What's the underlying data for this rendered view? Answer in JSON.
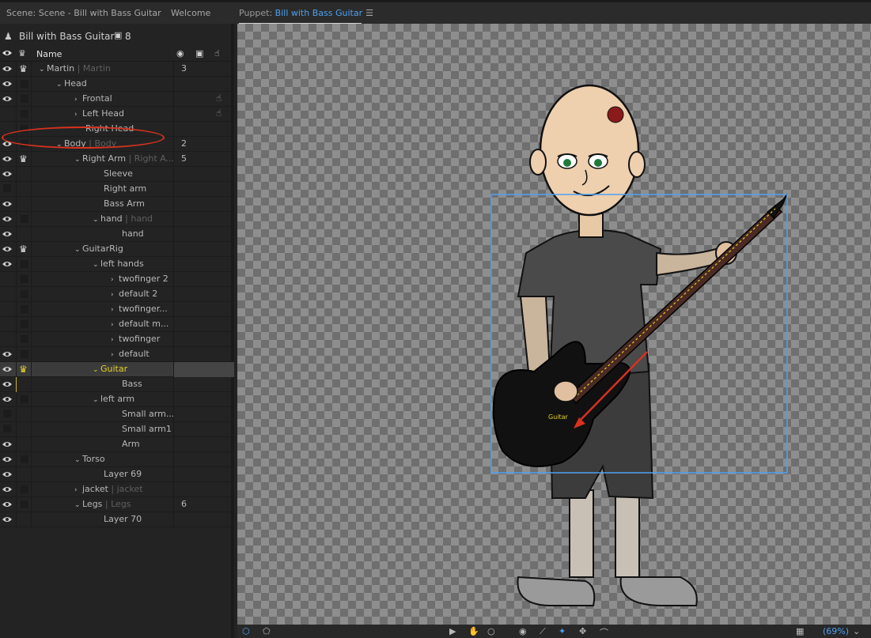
{
  "tabs": {
    "scene": "Scene: Scene - Bill with Bass Guitar",
    "welcome": "Welcome",
    "puppet_prefix": "Puppet: ",
    "puppet_name": "Bill with Bass Guitar"
  },
  "puppet_panel": {
    "title": "Bill with Bass Guitar",
    "count": "8",
    "column_name": "Name"
  },
  "layers": [
    {
      "label": "Martin",
      "suffix": "Martin",
      "num": "3",
      "caret": "⌄",
      "crown": true
    },
    {
      "label": "Head",
      "suffix": "",
      "num": "",
      "caret": "⌄"
    },
    {
      "label": "Frontal",
      "suffix": "",
      "num": "",
      "caret": "›"
    },
    {
      "label": "Left  Head",
      "suffix": "",
      "num": "",
      "caret": "›"
    },
    {
      "label": "Right Head",
      "suffix": "",
      "num": "",
      "caret": ""
    },
    {
      "label": "Body",
      "suffix": "Body",
      "num": "2",
      "caret": "⌄"
    },
    {
      "label": "Right Arm",
      "suffix": "Right A...",
      "num": "5",
      "caret": "⌄",
      "crown": true
    },
    {
      "label": "Sleeve",
      "suffix": "",
      "num": "",
      "caret": ""
    },
    {
      "label": "Right arm",
      "suffix": "",
      "num": "",
      "caret": ""
    },
    {
      "label": "Bass Arm",
      "suffix": "",
      "num": "",
      "caret": ""
    },
    {
      "label": "hand",
      "suffix": "hand",
      "num": "",
      "caret": "⌄"
    },
    {
      "label": "hand",
      "suffix": "",
      "num": "",
      "caret": ""
    },
    {
      "label": "GuitarRig",
      "suffix": "",
      "num": "",
      "caret": "⌄",
      "crown": true
    },
    {
      "label": "left hands",
      "suffix": "",
      "num": "",
      "caret": "⌄"
    },
    {
      "label": "twofinger 2",
      "suffix": "",
      "num": "",
      "caret": "›"
    },
    {
      "label": "default 2",
      "suffix": "",
      "num": "",
      "caret": "›"
    },
    {
      "label": "twofinger...",
      "suffix": "",
      "num": "",
      "caret": "›"
    },
    {
      "label": "default m...",
      "suffix": "",
      "num": "",
      "caret": "›"
    },
    {
      "label": "twofinger",
      "suffix": "",
      "num": "",
      "caret": "›"
    },
    {
      "label": "default",
      "suffix": "",
      "num": "",
      "caret": "›"
    },
    {
      "label": "Guitar",
      "suffix": "",
      "num": "",
      "caret": "⌄",
      "crown": true
    },
    {
      "label": "Bass",
      "suffix": "",
      "num": "",
      "caret": ""
    },
    {
      "label": "left arm",
      "suffix": "",
      "num": "",
      "caret": "⌄"
    },
    {
      "label": "Small arm...",
      "suffix": "",
      "num": "",
      "caret": ""
    },
    {
      "label": "Small arm1",
      "suffix": "",
      "num": "",
      "caret": ""
    },
    {
      "label": "Arm",
      "suffix": "",
      "num": "",
      "caret": ""
    },
    {
      "label": "Torso",
      "suffix": "",
      "num": "",
      "caret": "⌄"
    },
    {
      "label": "Layer 69",
      "suffix": "",
      "num": "",
      "caret": ""
    },
    {
      "label": "jacket",
      "suffix": "jacket",
      "num": "",
      "caret": "›"
    },
    {
      "label": "Legs",
      "suffix": "Legs",
      "num": "6",
      "caret": "⌄"
    },
    {
      "label": "Layer 70",
      "suffix": "",
      "num": "",
      "caret": ""
    }
  ],
  "canvas": {
    "guitar_label": "Guitar"
  },
  "bottombar": {
    "zoom": "(69%)"
  },
  "colors": {
    "accent_blue": "#4ea0f0",
    "selected_yellow": "#e6d22a",
    "annotation_red": "#d8321e"
  }
}
